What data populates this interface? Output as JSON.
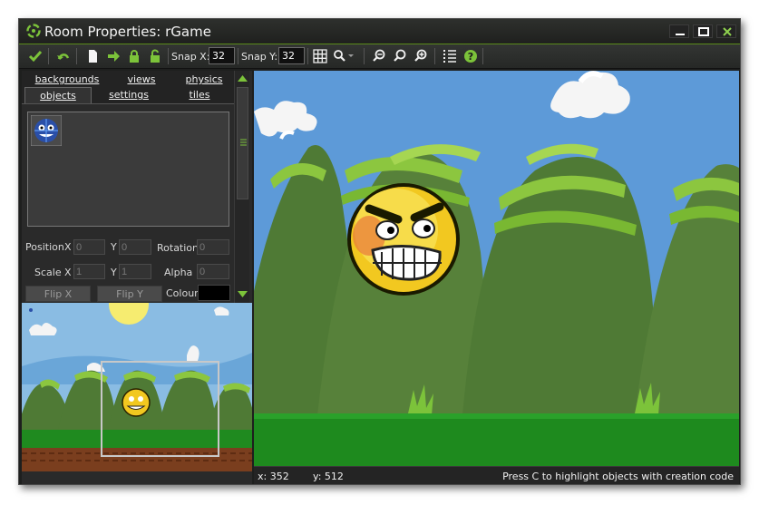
{
  "window": {
    "title": "Room Properties: rGame"
  },
  "toolbar": {
    "snap_x_label": "Snap X:",
    "snap_x_value": "32",
    "snap_y_label": "Snap Y:",
    "snap_y_value": "32"
  },
  "tabs": {
    "row1": [
      "backgrounds",
      "views",
      "physics"
    ],
    "row2": [
      "objects",
      "settings",
      "tiles"
    ],
    "active": "objects"
  },
  "properties": {
    "position_label": "Position",
    "x_label": "X",
    "y_label": "Y",
    "position_x": "0",
    "position_y": "0",
    "rotation_label": "Rotation",
    "rotation_value": "0",
    "scale_label": "Scale",
    "scale_x": "1",
    "scale_y": "1",
    "alpha_label": "Alpha",
    "alpha_value": "0",
    "flip_x_label": "Flip X",
    "flip_y_label": "Flip Y",
    "colour_label": "Colour",
    "colour_value": "#000000"
  },
  "status": {
    "x": "x: 352",
    "y": "y: 512",
    "hint": "Press C to highlight objects with creation code"
  },
  "colors": {
    "accent": "#6fbf2a",
    "window_bg": "#1e1f1e",
    "sky": "#5a96d6",
    "hill_dark": "#4f7a35",
    "hill_light": "#8cc63f",
    "grass": "#1e8a1e"
  },
  "icons": [
    "app-logo-icon",
    "check-icon",
    "undo-icon",
    "new-icon",
    "arrow-right-icon",
    "lock-icon",
    "unlock-icon",
    "grid-icon",
    "zoom-dropdown-icon",
    "zoom-in-icon",
    "zoom-out-icon",
    "zoom-reset-icon",
    "list-icon",
    "help-icon",
    "minimize-icon",
    "maximize-icon",
    "close-icon"
  ]
}
